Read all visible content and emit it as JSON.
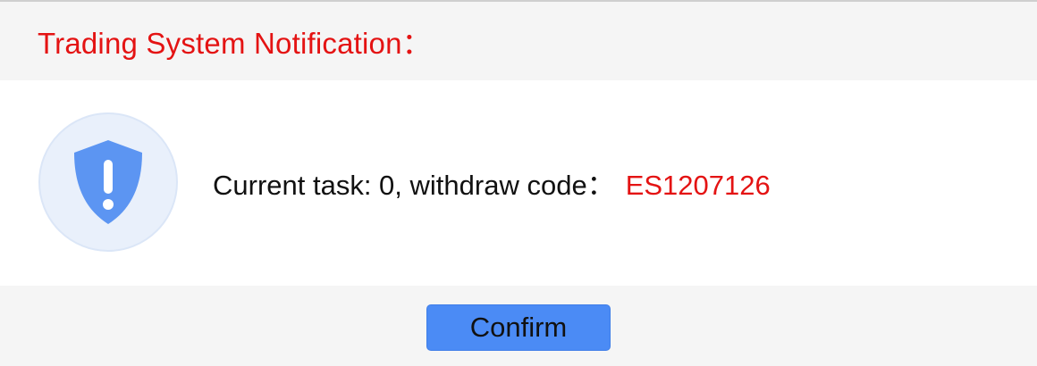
{
  "dialog": {
    "title": "Trading System Notification：",
    "message_prefix": "Current task: 0, withdraw code：",
    "withdraw_code": "ES1207126",
    "confirm_label": "Confirm",
    "icon": "shield-exclamation-icon"
  },
  "colors": {
    "title": "#e41313",
    "code": "#e41313",
    "button": "#4b8bf5",
    "header_bg": "#f5f5f5",
    "icon_bg": "#e9f0fb",
    "shield": "#5c95f2"
  }
}
